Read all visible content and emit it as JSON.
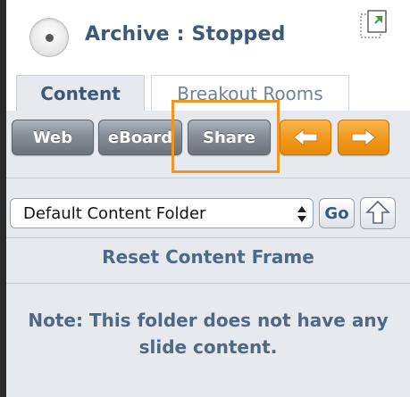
{
  "header": {
    "status_title": "Archive : Stopped",
    "status_icon": "radio-dot-icon",
    "popout_icon": "popout-window-icon"
  },
  "tabs": [
    {
      "label": "Content",
      "active": true
    },
    {
      "label": "Breakout Rooms",
      "active": false
    }
  ],
  "toolbar": {
    "web_label": "Web",
    "eboard_label": "eBoard",
    "share_label": "Share",
    "prev_icon": "arrow-left-icon",
    "next_icon": "arrow-right-icon",
    "highlighted": "Share"
  },
  "folder": {
    "selected": "Default Content Folder",
    "go_label": "Go",
    "up_icon": "folder-up-icon"
  },
  "reset_label": "Reset Content Frame",
  "note": "Note: This folder does not have any slide content.",
  "colors": {
    "accent_text": "#3b5a78",
    "panel_bg": "#e6e9ee",
    "button_gray": "#868d95",
    "button_orange": "#f19a1e",
    "highlight": "#f4931f"
  }
}
